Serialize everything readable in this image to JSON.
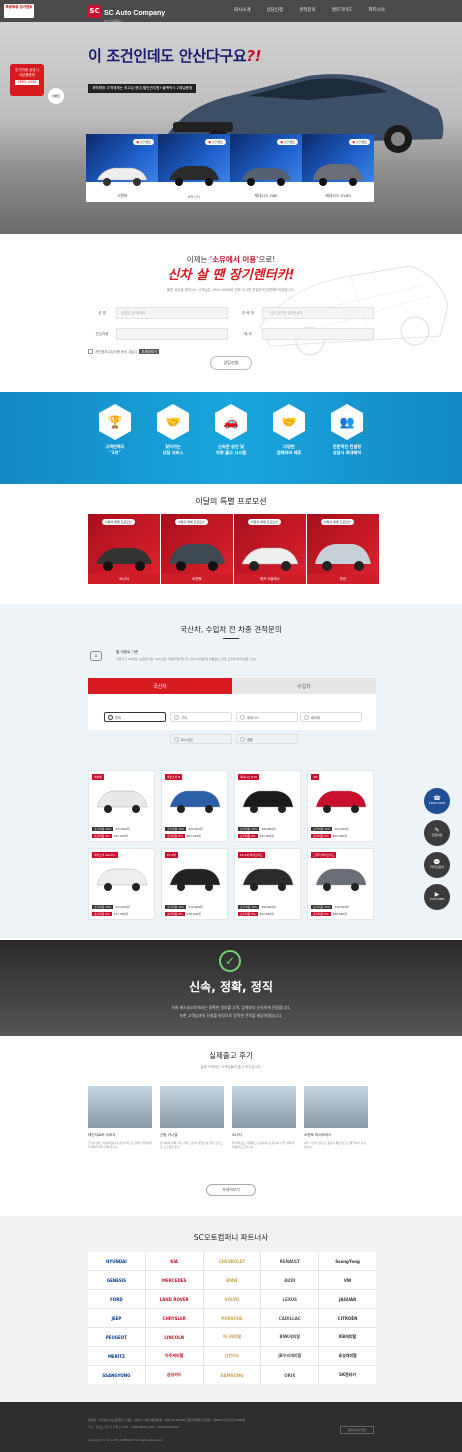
{
  "header": {
    "mini_logo": "부릉부릉 장기렌트",
    "brand": "SC Auto Company",
    "brand_sub": "SC오토컴퍼니",
    "nav": [
      "회사소개",
      "상담신청",
      "견적문의",
      "렌트가이드",
      "파트너사"
    ]
  },
  "hero": {
    "title_part1": "이 조건인데도 ",
    "title_part2": "안산다구요",
    "title_q": "?!",
    "banner": "계약확정 고객에게는 최고급 현대 할인권지원+블랙박스 2채널증정",
    "badge_lines": [
      "인기차종 상담시",
      "사은품증정"
    ],
    "badge_phone": "1899-0058",
    "badge_circle": "이벤트",
    "cards": [
      {
        "tag": "인기렌트",
        "name": "그랜저"
      },
      {
        "tag": "인기렌트",
        "name": "K5 (7)"
      },
      {
        "tag": "인기렌트",
        "name": "제네시스 G80"
      },
      {
        "tag": "인기렌트",
        "name": "제네시스 GV80"
      }
    ]
  },
  "consult": {
    "sub_part1": "이제는 ",
    "sub_hl": "'소유에서 이용'",
    "sub_part2": "으로!",
    "main": "신차 살 땐 장기렌터카!",
    "desc": "빠른 상담을 원하시는 고객님은 1899-0058로 전화 주시면 친절하게 답변해드리겠습니다.",
    "fields": {
      "name_label": "성 명",
      "name_ph": "성명을 입력하세요.",
      "phone_label": "연 락 처",
      "phone_ph": "'-' 없이 숫자만 입력하세요.",
      "car_label": "관심차종",
      "car_ph": "",
      "memo_label": "메 모",
      "memo_ph": ""
    },
    "agree": "개인정보수집이용 동의 (필수)",
    "view_btn": "자세히보기",
    "submit": "상담신청"
  },
  "benefits": [
    {
      "icon": "trophy-icon",
      "glyph": "🏆",
      "t1": "고객만족도",
      "t2": "\"1위\""
    },
    {
      "icon": "visit-icon",
      "glyph": "🤝",
      "t1": "찾아가는",
      "t2": "상담 서비스"
    },
    {
      "icon": "car-icon",
      "glyph": "🚗",
      "t1": "신속한 승인 및",
      "t2": "차량 출고 시스템"
    },
    {
      "icon": "handshake-icon",
      "glyph": "🤝",
      "t1": "다양한",
      "t2": "업체와의 제휴"
    },
    {
      "icon": "people-icon",
      "glyph": "👥",
      "t1": "전문적인 컨설팅",
      "t2": "상담사 최대배치"
    }
  ],
  "promo": {
    "title": "이달의 특별 프로모션",
    "cards": [
      {
        "tag": "이달의 특별 프로모션",
        "name": "쏘나타"
      },
      {
        "tag": "이달의 특별 프로모션",
        "name": "쏘렌토"
      },
      {
        "tag": "이달의 특별 프로모션",
        "name": "벤츠 E클래스"
      },
      {
        "tag": "이달의 특별 프로모션",
        "name": "투싼"
      }
    ]
  },
  "estimate": {
    "title": "국산차, 수입차 전 차종 견적문의",
    "info_title": "월 이용료 기준",
    "info_desc": "이용기간 48개월, 보증금 0원, SKT보험, 약정주행거리 연 2만km이용(월 이용료는 견적 조정에 따라 변동 가능)",
    "tab_domestic": "국산차",
    "tab_import": "수입차",
    "brands": [
      "현대",
      "기아",
      "제네시스",
      "쉐보레",
      "르노삼성",
      "쌍용"
    ],
    "vehicles": [
      {
        "tag": "아반떼",
        "p1_label": "초기비용 30%",
        "p1": "233,600원",
        "p2_label": "초기비용 0%",
        "p2": "327,200원"
      },
      {
        "tag": "벨로스터 N",
        "p1_label": "초기비용 30%",
        "p1": "429,300원",
        "p2_label": "초기비용 0%",
        "p2": "697,200원"
      },
      {
        "tag": "제네시스 G70",
        "p1_label": "초기비용 30%",
        "p1": "293,800원",
        "p2_label": "초기비용 0%",
        "p2": "422,600원"
      },
      {
        "tag": "i30",
        "p1_label": "초기비용 30%",
        "p1": "303,000원",
        "p2_label": "초기비용 0%",
        "p2": "465,900원"
      },
      {
        "tag": "아이오닉 electric",
        "p1_label": "초기비용 30%",
        "p1": "233,200원",
        "p2_label": "초기비용 0%",
        "p2": "317,300원"
      },
      {
        "tag": "K5 2세",
        "p1_label": "초기비용 30%",
        "p1": "272,900원",
        "p2_label": "초기비용 0%",
        "p2": "126,200원"
      },
      {
        "tag": "K5 2세 하이브리드",
        "p1_label": "초기비용 30%",
        "p1": "286,400원",
        "p2_label": "초기비용 0%",
        "p2": "402,600원"
      },
      {
        "tag": "그랜저 하이브리드",
        "p1_label": "초기비용 30%",
        "p1": "336,300원",
        "p2_label": "초기비용 0%",
        "p2": "338,900원"
      }
    ]
  },
  "floats": [
    {
      "icon": "phone-icon",
      "label": "1899-0058"
    },
    {
      "icon": "consult-icon",
      "label": "간편상담"
    },
    {
      "icon": "kakao-icon",
      "label": "카카오문의"
    },
    {
      "icon": "youtube-icon",
      "label": "YOUTUBE"
    }
  ],
  "slogan": {
    "title": "신속, 정확, 정직",
    "line1": "저희 에스씨오토에서는 정확한 정보를 고객, 업체보다 신속하게 전달합니다.",
    "line2": "또한 고객님과의 신뢰를 바탕으로 정직한 견적을 제공하겠습니다."
  },
  "reviews": {
    "title": "실제출고 후기",
    "sub": "실제 구매하신 고객님들의 출고 후기입니다.",
    "items": [
      {
        "name": "레인지로버 이보크",
        "text": "첫 장기렌트 이용이었는데 상담부터 출고까지 친절하게 안내해주셔서 만족합니다."
      },
      {
        "name": "신형 카니발",
        "text": "온가족이 함께 타는 차라 고민이 많았는데 좋은 조건으로 출고했습니다."
      },
      {
        "name": "쏘나타",
        "text": "월 이용료도 저렴하고 보험까지 포함되어 너무 편하게 이용하고 있습니다."
      },
      {
        "name": "쏘렌토 하이브리드",
        "text": "대기 기간이 길다고 했는데 빠르게 출고해주셔서 감사합니다."
      }
    ],
    "more": "자세히보기"
  },
  "partners": {
    "title": "SC오토컴퍼니 파트너사",
    "logos": [
      "HYUNDAI",
      "KIA",
      "CHEVROLET",
      "RENAULT",
      "SsangYong",
      "GENESIS",
      "MERCEDES",
      "BMW",
      "AUDI",
      "VW",
      "FORD",
      "LAND ROVER",
      "VOLVO",
      "LEXUS",
      "JAGUAR",
      "JEEP",
      "CHRYSLER",
      "PORSCHE",
      "CADILLAC",
      "CITROËN",
      "PEUGEOT",
      "LINCOLN",
      "하나캐피탈",
      "BNK캐피탈",
      "KB캐피탈",
      "MERITZ",
      "아주캐피탈",
      "신한카드",
      "JB우리캐피탈",
      "효성캐피탈",
      "SSANGYONG",
      "삼성카드",
      "SAMSUNG",
      "ORIX",
      "SK렌터카"
    ]
  },
  "footer": {
    "line1": "회사명 : (주)에스씨오토컴퍼니 | 대표 : 김OO | 사업자등록번호 : 000-00-00000 | 통신판매업신고번호 : 제0000-경기안산-0000호",
    "line2": "주소 : 경기도 안산시 단원구 | TEL : 1899-0058 | FAX : 000-0000-0000",
    "copy": "Copyright © SC AUTO COMPANY. All Rights Reserved.",
    "btn": "개인정보처리방침"
  }
}
